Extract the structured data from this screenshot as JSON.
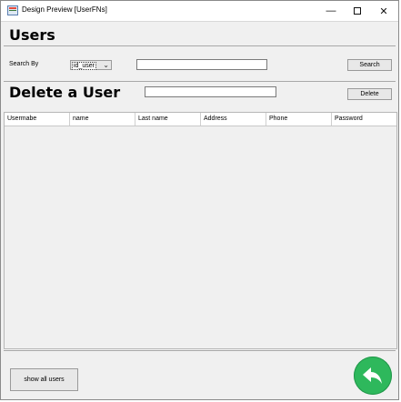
{
  "window": {
    "title": "Design Preview [UserFNs]"
  },
  "users_section": {
    "heading": "Users",
    "search_by_label": "Search By",
    "search_by_selected": "id_user",
    "search_input_value": "",
    "search_button": "Search"
  },
  "delete_section": {
    "heading": "Delete a User",
    "delete_input_value": "",
    "delete_button": "Delete"
  },
  "table": {
    "columns": [
      "Usermabe",
      "name",
      "Last name",
      "Address",
      "Phone",
      "Password"
    ],
    "rows": []
  },
  "footer": {
    "show_all_button": "show all  users",
    "back_button_icon": "undo-arrow-icon",
    "back_button_color": "#2eb85c"
  }
}
